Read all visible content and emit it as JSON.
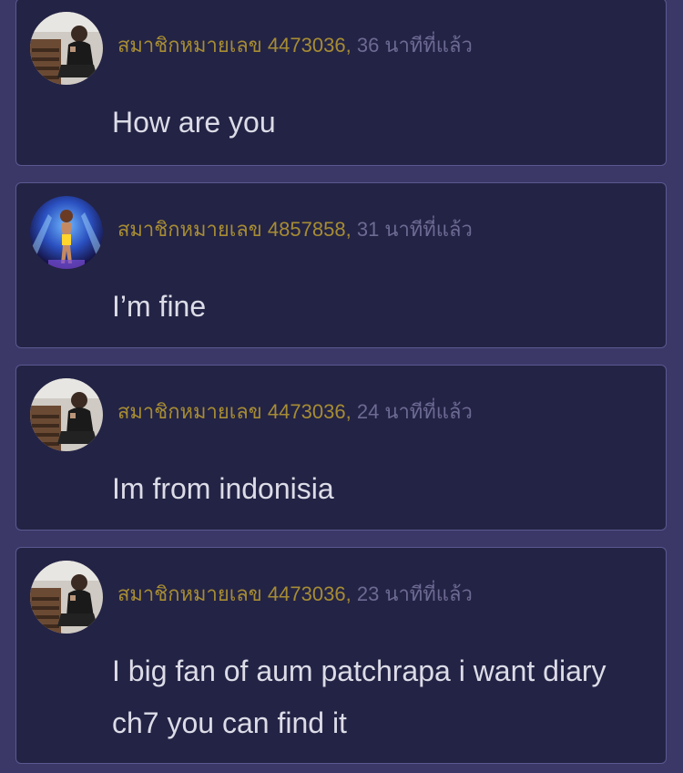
{
  "comments": [
    {
      "user": "สมาชิกหมายเลข 4473036",
      "time": "36 นาทีที่แล้ว",
      "text": "How are you",
      "avatar_icon": "user-photo-man-sitting"
    },
    {
      "user": "สมาชิกหมายเลข 4857858",
      "time": "31 นาทีที่แล้ว",
      "text": "I’m fine",
      "avatar_icon": "user-photo-woman-stage"
    },
    {
      "user": "สมาชิกหมายเลข 4473036",
      "time": "24 นาทีที่แล้ว",
      "text": "Im from indonisia",
      "avatar_icon": "user-photo-man-sitting"
    },
    {
      "user": "สมาชิกหมายเลข 4473036",
      "time": "23 นาทีที่แล้ว",
      "text": "I big fan of aum patchrapa i want diary ch7 you can find it",
      "avatar_icon": "user-photo-man-sitting"
    }
  ],
  "colors": {
    "page_background": "#3b3868",
    "card_background": "#232345",
    "card_border": "#5a5890",
    "username": "#a68c34",
    "timestamp": "#6d6a93",
    "message_text": "#dcdce8"
  }
}
